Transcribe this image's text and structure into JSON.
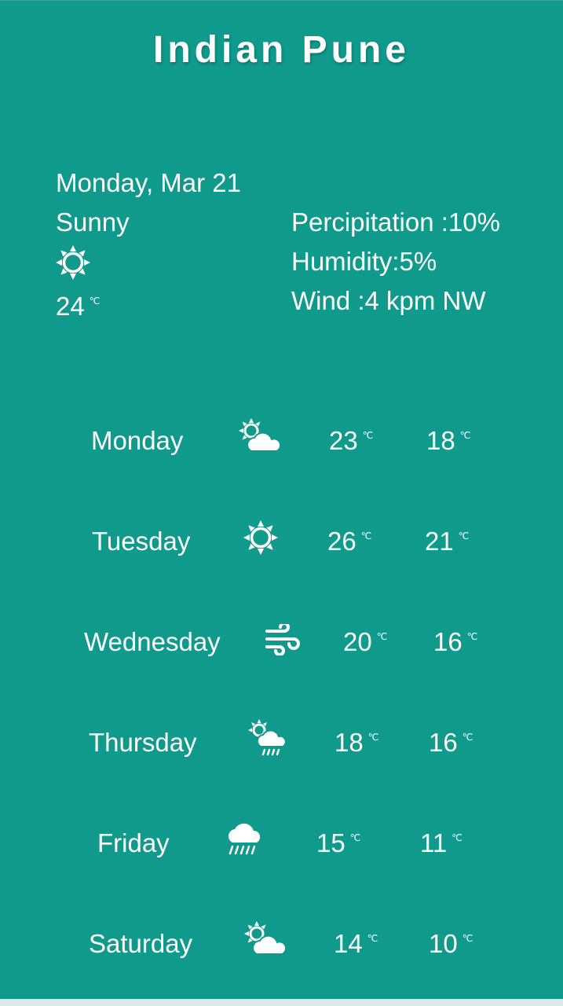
{
  "city": "Indian Pune",
  "current": {
    "date": "Monday, Mar 21",
    "condition": "Sunny",
    "icon": "sun-icon",
    "temp": "24",
    "unit": "℃",
    "precipitation": "Percipitation :10%",
    "humidity": "Humidity:5%",
    "wind": "Wind :4 kpm NW"
  },
  "forecast": [
    {
      "day": "Monday",
      "icon": "partly-cloudy-icon",
      "high": "23",
      "low": "18",
      "unit": "℃"
    },
    {
      "day": "Tuesday",
      "icon": "sun-icon",
      "high": "26",
      "low": "21",
      "unit": "℃"
    },
    {
      "day": "Wednesday",
      "icon": "wind-icon",
      "high": "20",
      "low": "16",
      "unit": "℃"
    },
    {
      "day": "Thursday",
      "icon": "sun-cloud-rain-icon",
      "high": "18",
      "low": "16",
      "unit": "℃"
    },
    {
      "day": "Friday",
      "icon": "cloud-rain-icon",
      "high": "15",
      "low": "11",
      "unit": "℃"
    },
    {
      "day": "Saturday",
      "icon": "partly-cloudy-icon",
      "high": "14",
      "low": "10",
      "unit": "℃"
    }
  ],
  "colors": {
    "background": "#0f9a8c",
    "text": "#ffffff"
  }
}
